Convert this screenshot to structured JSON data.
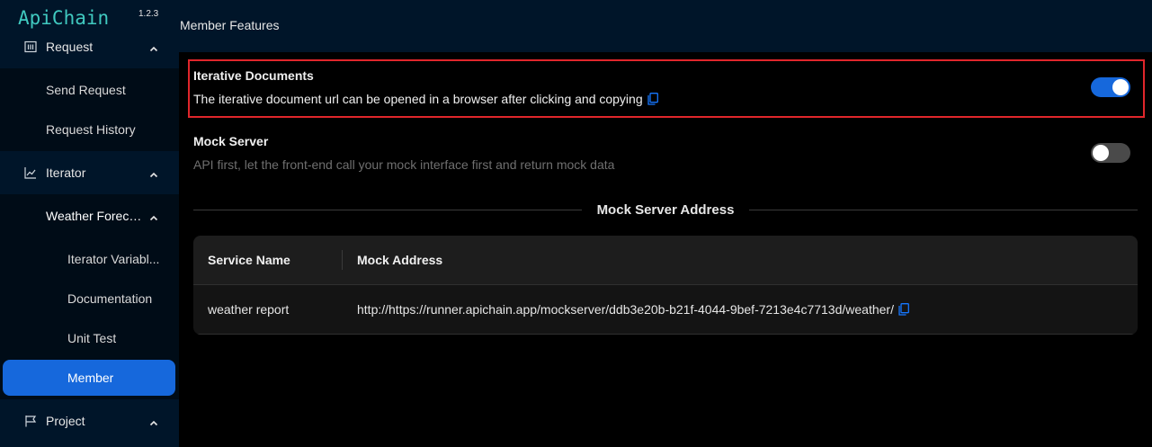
{
  "app": {
    "name": "ApiChain",
    "version": "1.2.3"
  },
  "sidebar": {
    "groups": {
      "request": {
        "label": "Request",
        "icon": "request-icon"
      },
      "iterator": {
        "label": "Iterator",
        "icon": "line-chart-icon"
      },
      "project": {
        "label": "Project",
        "icon": "flag-icon"
      }
    },
    "request_items": [
      "Send Request",
      "Request History"
    ],
    "iterator_sub": {
      "label": "Weather Foreca..."
    },
    "weather_items": [
      "Iterator Variabl...",
      "Documentation",
      "Unit Test",
      "Member"
    ],
    "active_item": "Member"
  },
  "header": {
    "title": "Member Features"
  },
  "features": {
    "iterative": {
      "title": "Iterative Documents",
      "description": "The iterative document url can be opened in a browser after clicking and copying",
      "enabled": true
    },
    "mock": {
      "title": "Mock Server",
      "description": "API first, let the front-end call your mock interface first and return mock data",
      "enabled": false
    }
  },
  "mock_section": {
    "title": "Mock Server Address"
  },
  "table": {
    "columns": [
      "Service Name",
      "Mock Address"
    ],
    "rows": [
      {
        "service": "weather report",
        "address": "http://https://runner.apichain.app/mockserver/ddb3e20b-b21f-4044-9bef-7213e4c7713d/weather/"
      }
    ]
  },
  "colors": {
    "accent": "#1668dc",
    "logo": "#40c9c0",
    "highlight_border": "#e0262b",
    "sidebar_bg": "#001529"
  }
}
